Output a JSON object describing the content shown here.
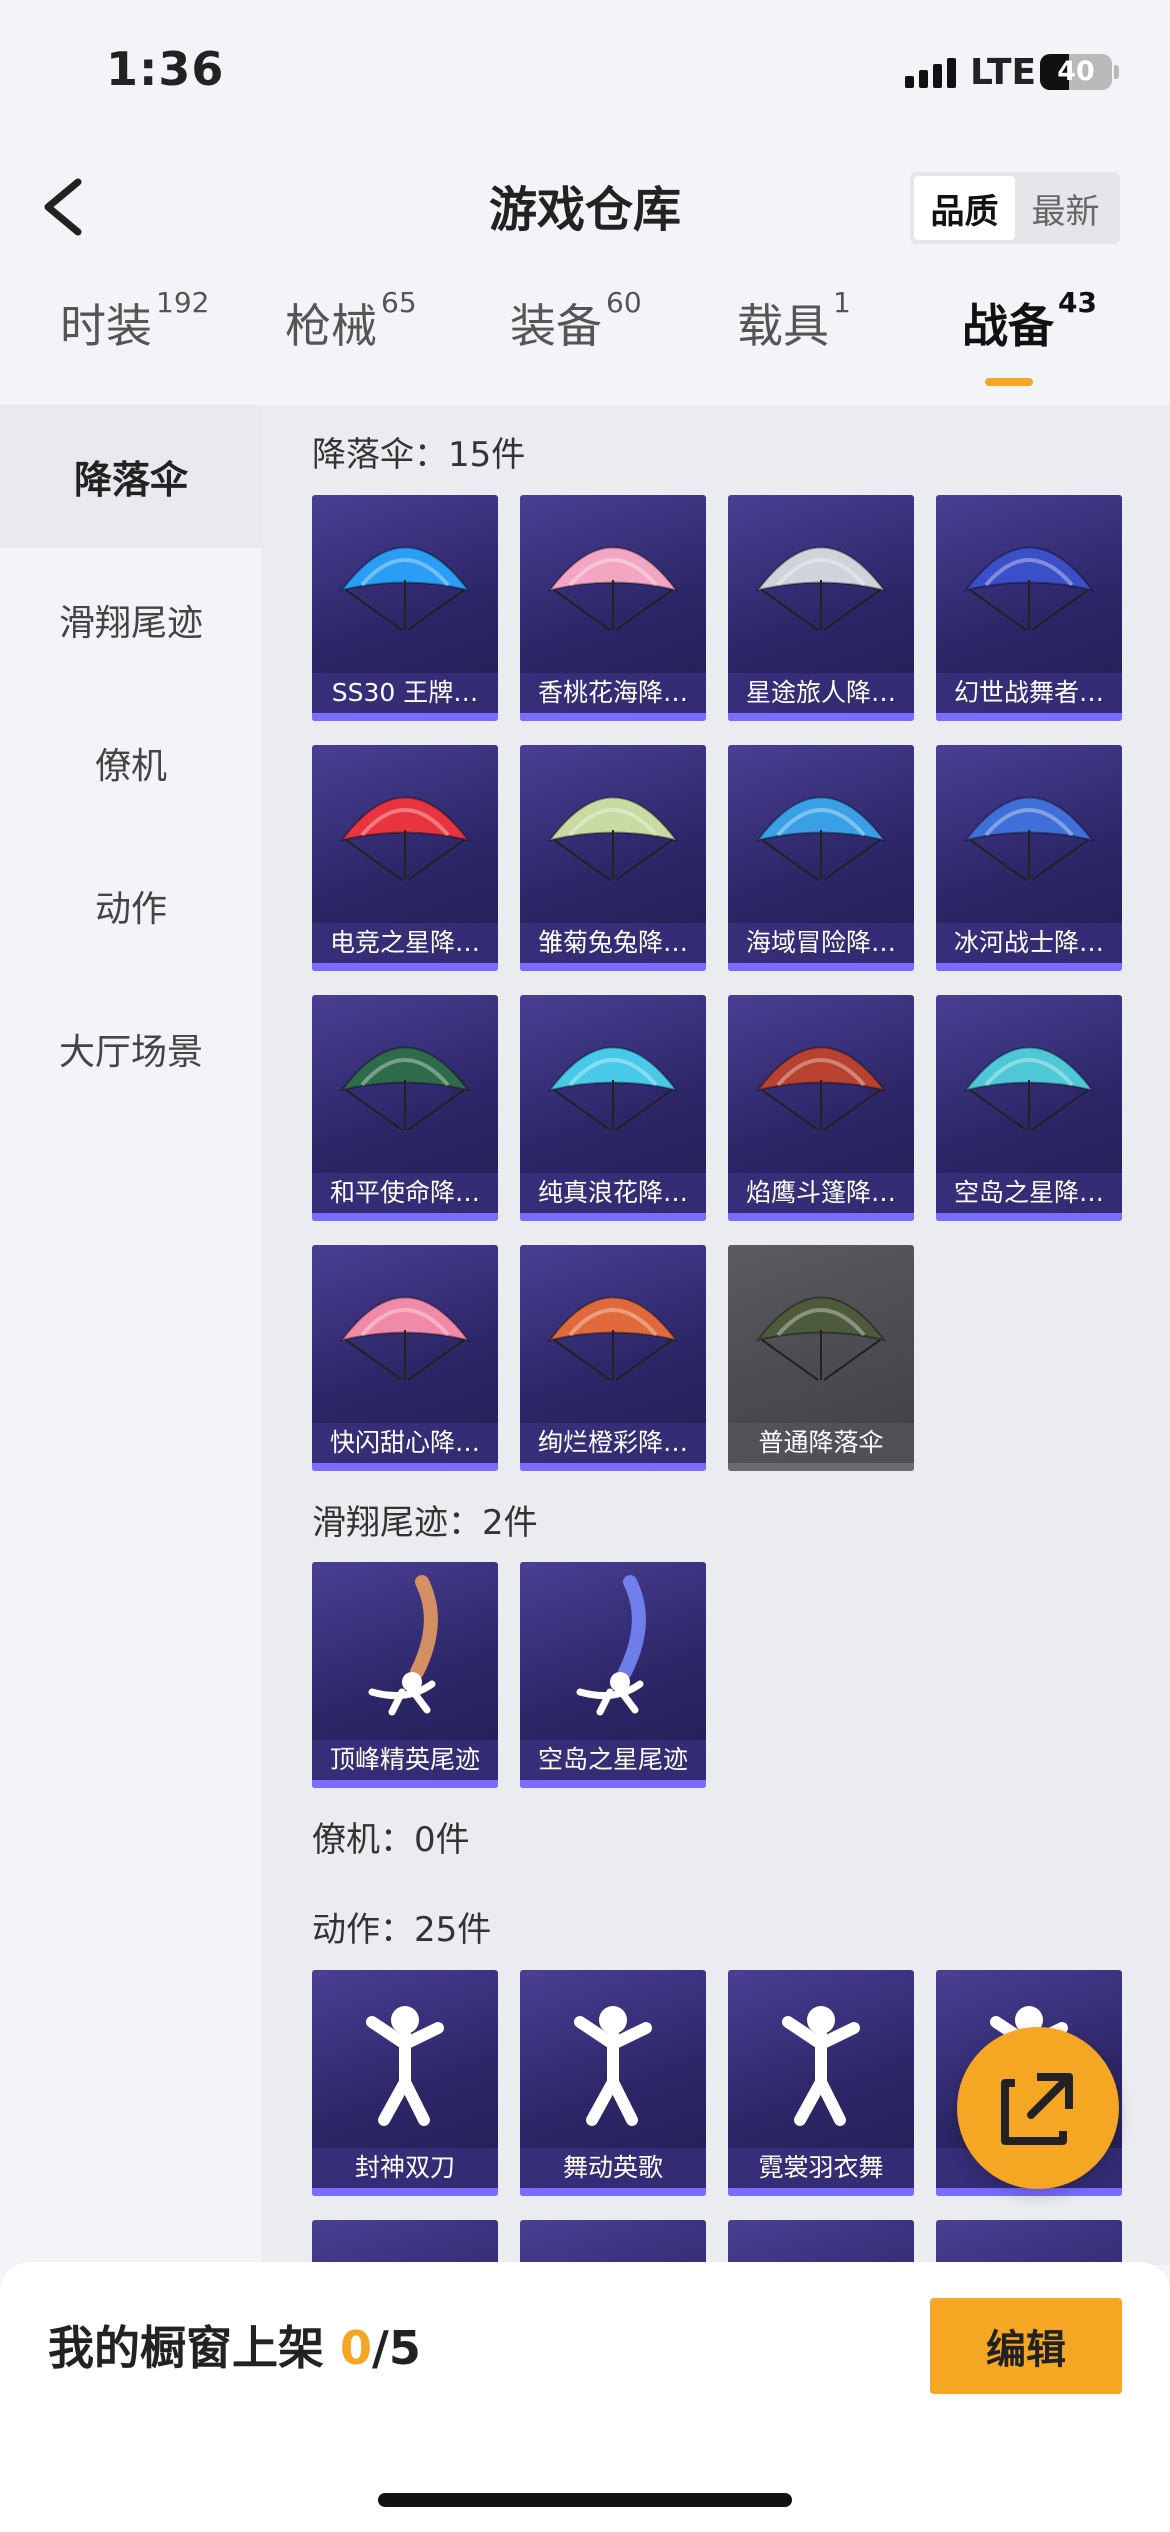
{
  "status": {
    "time": "1:36",
    "network": "LTE",
    "battery": "40",
    "battery_level": 0.4
  },
  "nav": {
    "title": "游戏仓库",
    "sort_options": [
      "品质",
      "最新"
    ],
    "sort_selected": "品质"
  },
  "tabs": [
    {
      "label": "时装",
      "count": "192"
    },
    {
      "label": "枪械",
      "count": "65"
    },
    {
      "label": "装备",
      "count": "60"
    },
    {
      "label": "载具",
      "count": "1"
    },
    {
      "label": "战备",
      "count": "43",
      "active": true
    }
  ],
  "sidebar": {
    "items": [
      "降落伞",
      "滑翔尾迹",
      "僚机",
      "动作",
      "大厅场景"
    ],
    "selected": "降落伞"
  },
  "sections": {
    "parachute": {
      "title": "降落伞：15件",
      "items": [
        "SS30 王牌…",
        "香桃花海降…",
        "星途旅人降…",
        "幻世战舞者…",
        "电竞之星降…",
        "雏菊兔兔降…",
        "海域冒险降…",
        "冰河战士降…",
        "和平使命降…",
        "纯真浪花降…",
        "焰鹰斗篷降…",
        "空岛之星降…",
        "快闪甜心降…",
        "绚烂橙彩降…",
        "普通降落伞"
      ],
      "colors": [
        "#2a9df4",
        "#f2a6c2",
        "#cfd3da",
        "#3b4fc9",
        "#e8343f",
        "#c8dba0",
        "#3aa0e6",
        "#3f6fd8",
        "#2e6b4a",
        "#48c9e8",
        "#b8412f",
        "#4ec7d6",
        "#f08aa8",
        "#e06a3b",
        "#4e5a3c"
      ]
    },
    "trail": {
      "title": "滑翔尾迹：2件",
      "items": [
        "顶峰精英尾迹",
        "空岛之星尾迹"
      ]
    },
    "wingman": {
      "title": "僚机：0件"
    },
    "emote": {
      "title": "动作：25件",
      "items": [
        "封神双刀",
        "舞动英歌",
        "霓裳羽衣舞",
        ""
      ]
    }
  },
  "footer": {
    "label": "我的橱窗上架",
    "current": "0",
    "total": "/5",
    "edit_label": "编辑"
  }
}
